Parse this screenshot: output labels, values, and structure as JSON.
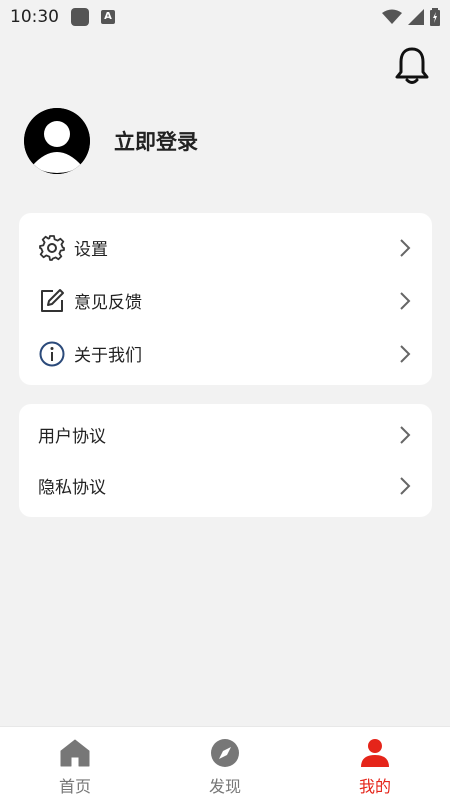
{
  "status_bar": {
    "time": "10:30"
  },
  "profile": {
    "login_text": "立即登录"
  },
  "menu_group1": [
    {
      "label": "设置",
      "icon": "gear-icon"
    },
    {
      "label": "意见反馈",
      "icon": "edit-icon"
    },
    {
      "label": "关于我们",
      "icon": "info-icon"
    }
  ],
  "menu_group2": [
    {
      "label": "用户协议"
    },
    {
      "label": "隐私协议"
    }
  ],
  "bottom_nav": [
    {
      "label": "首页",
      "icon": "home-icon"
    },
    {
      "label": "发现",
      "icon": "compass-icon"
    },
    {
      "label": "我的",
      "icon": "person-icon",
      "active": true
    }
  ],
  "colors": {
    "accent": "#e5251a",
    "background": "#f2f2f2",
    "inactive": "#777777"
  }
}
